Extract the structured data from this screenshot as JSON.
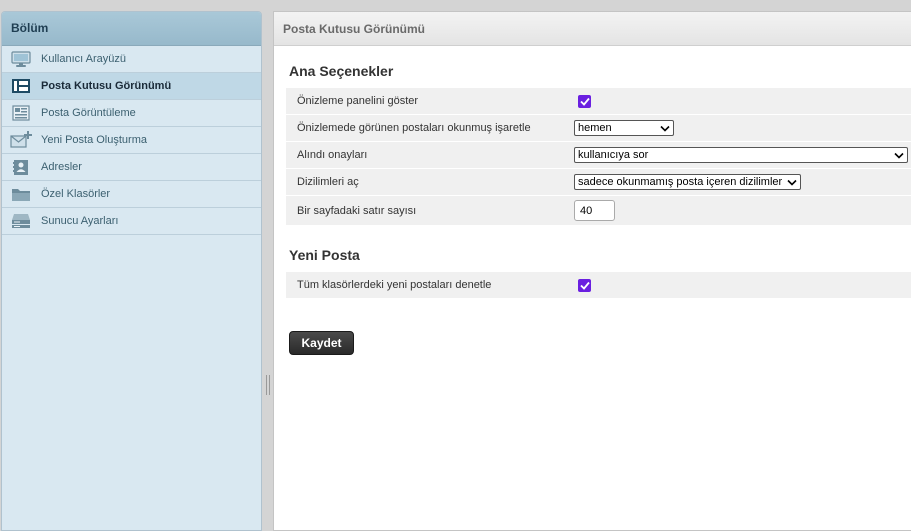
{
  "sidebar": {
    "title": "Bölüm",
    "items": [
      {
        "label": "Kullanıcı Arayüzü",
        "icon": "monitor-icon"
      },
      {
        "label": "Posta Kutusu Görünümü",
        "icon": "mailbox-view-icon",
        "selected": true
      },
      {
        "label": "Posta Görüntüleme",
        "icon": "message-view-icon"
      },
      {
        "label": "Yeni Posta Oluşturma",
        "icon": "compose-icon"
      },
      {
        "label": "Adresler",
        "icon": "addressbook-icon"
      },
      {
        "label": "Özel Klasörler",
        "icon": "folder-icon"
      },
      {
        "label": "Sunucu Ayarları",
        "icon": "server-icon"
      }
    ]
  },
  "main": {
    "title": "Posta Kutusu Görünümü",
    "sections": [
      {
        "title": "Ana Seçenekler",
        "rows": [
          {
            "label": "Önizleme panelini göster",
            "type": "checkbox",
            "checked": true
          },
          {
            "label": "Önizlemede görünen postaları okunmuş işaretle",
            "type": "select",
            "value": "hemen"
          },
          {
            "label": "Alındı onayları",
            "type": "select",
            "value": "kullanıcıya sor"
          },
          {
            "label": "Dizilimleri aç",
            "type": "select",
            "value": "sadece okunmamış posta içeren dizilimler"
          },
          {
            "label": "Bir sayfadaki satır sayısı",
            "type": "number",
            "value": "40"
          }
        ]
      },
      {
        "title": "Yeni Posta",
        "rows": [
          {
            "label": "Tüm klasörlerdeki yeni postaları denetle",
            "type": "checkbox",
            "checked": true
          }
        ]
      }
    ],
    "save_label": "Kaydet"
  },
  "colors": {
    "accent_checkbox": "#6a1fe0",
    "sidebar_bg": "#d9e8f1",
    "selected_bg": "#bfd8e6"
  }
}
